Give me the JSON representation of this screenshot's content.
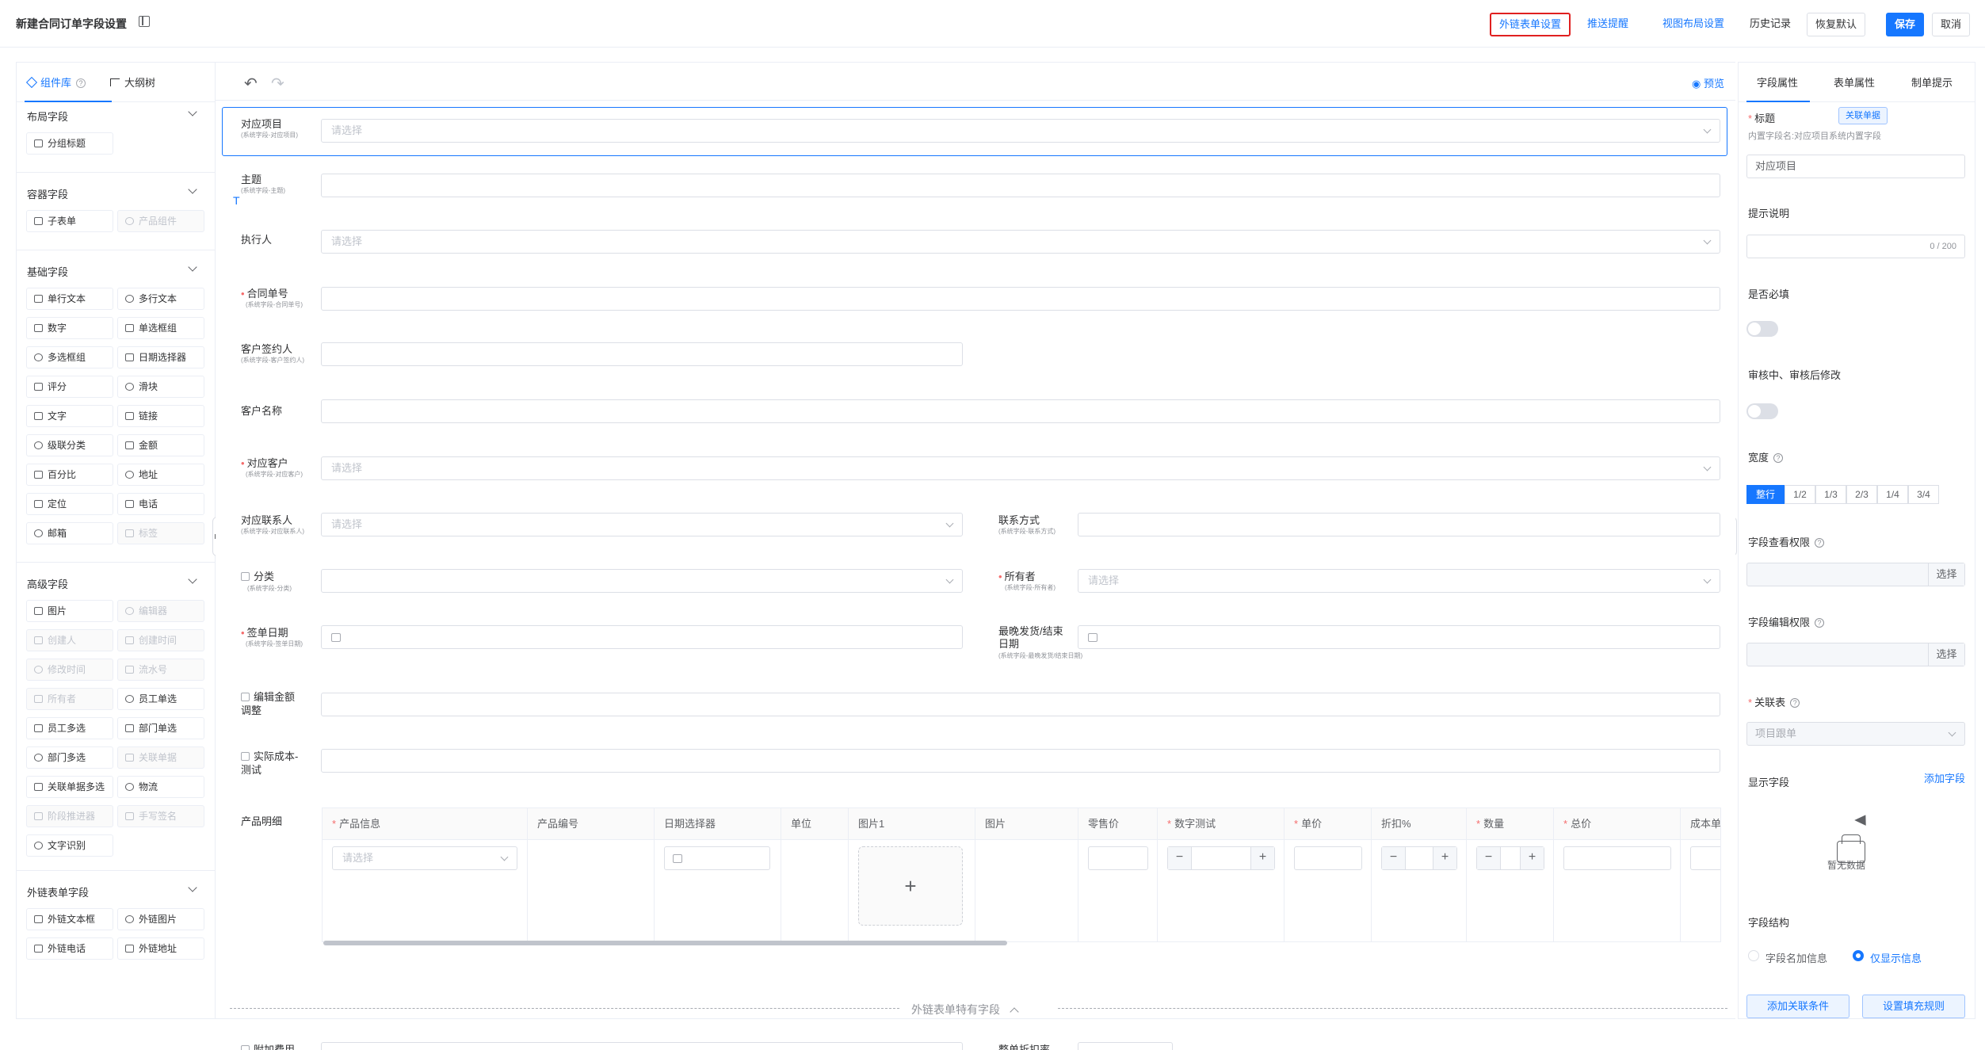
{
  "header": {
    "title": "新建合同订单字段设置",
    "actions": {
      "external_form": "外链表单设置",
      "push_reminder": "推送提醒",
      "view_layout": "视图布局设置",
      "history": "历史记录",
      "restore_default": "恢复默认",
      "save": "保存",
      "cancel": "取消"
    }
  },
  "left_panel": {
    "tabs": [
      "组件库",
      "大纲树"
    ],
    "groups": [
      {
        "title": "布局字段",
        "items": [
          {
            "label": "分组标题",
            "disabled": false
          }
        ]
      },
      {
        "title": "容器字段",
        "items": [
          {
            "label": "子表单",
            "disabled": false
          },
          {
            "label": "产品组件",
            "disabled": true
          }
        ]
      },
      {
        "title": "基础字段",
        "items": [
          {
            "label": "单行文本",
            "disabled": false
          },
          {
            "label": "多行文本",
            "disabled": false
          },
          {
            "label": "数字",
            "disabled": false
          },
          {
            "label": "单选框组",
            "disabled": false
          },
          {
            "label": "多选框组",
            "disabled": false
          },
          {
            "label": "日期选择器",
            "disabled": false
          },
          {
            "label": "评分",
            "disabled": false
          },
          {
            "label": "滑块",
            "disabled": false
          },
          {
            "label": "文字",
            "disabled": false
          },
          {
            "label": "链接",
            "disabled": false
          },
          {
            "label": "级联分类",
            "disabled": false
          },
          {
            "label": "金额",
            "disabled": false
          },
          {
            "label": "百分比",
            "disabled": false
          },
          {
            "label": "地址",
            "disabled": false
          },
          {
            "label": "定位",
            "disabled": false
          },
          {
            "label": "电话",
            "disabled": false
          },
          {
            "label": "邮箱",
            "disabled": false
          },
          {
            "label": "标签",
            "disabled": true
          }
        ]
      },
      {
        "title": "高级字段",
        "items": [
          {
            "label": "图片",
            "disabled": false
          },
          {
            "label": "编辑器",
            "disabled": true
          },
          {
            "label": "创建人",
            "disabled": true
          },
          {
            "label": "创建时间",
            "disabled": true
          },
          {
            "label": "修改时间",
            "disabled": true
          },
          {
            "label": "流水号",
            "disabled": true
          },
          {
            "label": "所有者",
            "disabled": true
          },
          {
            "label": "员工单选",
            "disabled": false
          },
          {
            "label": "员工多选",
            "disabled": false
          },
          {
            "label": "部门单选",
            "disabled": false
          },
          {
            "label": "部门多选",
            "disabled": false
          },
          {
            "label": "关联单据",
            "disabled": true
          },
          {
            "label": "关联单据多选",
            "disabled": false
          },
          {
            "label": "物流",
            "disabled": false
          },
          {
            "label": "阶段推进器",
            "disabled": true
          },
          {
            "label": "手写签名",
            "disabled": true
          },
          {
            "label": "文字识别",
            "disabled": false
          }
        ]
      },
      {
        "title": "外链表单字段",
        "items": [
          {
            "label": "外链文本框",
            "disabled": false
          },
          {
            "label": "外链图片",
            "disabled": false
          },
          {
            "label": "外链电话",
            "disabled": false
          },
          {
            "label": "外链地址",
            "disabled": false
          }
        ]
      }
    ]
  },
  "canvas": {
    "preview": "预览",
    "select_placeholder": "请选择",
    "fields": {
      "project": {
        "label": "对应项目",
        "sub": "(系统字段-对应项目)"
      },
      "subject": {
        "label": "主题",
        "sub": "(系统字段-主题)"
      },
      "executor": {
        "label": "执行人"
      },
      "contract_no": {
        "label": "合同单号",
        "sub": "(系统字段-合同单号)"
      },
      "signer": {
        "label": "客户签约人",
        "sub": "(系统字段-客户签约人)"
      },
      "customer_name": {
        "label": "客户名称"
      },
      "customer": {
        "label": "对应客户",
        "sub": "(系统字段-对应客户)"
      },
      "contact": {
        "label": "对应联系人",
        "sub": "(系统字段-对应联系人)"
      },
      "contact_method": {
        "label": "联系方式",
        "sub": "(系统字段-联系方式)"
      },
      "category": {
        "label": "分类",
        "sub": "(系统字段-分类)"
      },
      "owner": {
        "label": "所有者",
        "sub": "(系统字段-所有者)"
      },
      "sign_date": {
        "label": "签单日期",
        "sub": "(系统字段-签单日期)"
      },
      "latest_date": {
        "label1": "最晚发货/结束",
        "label2": "日期",
        "sub": "(系统字段-最晚发货/结束日期)"
      },
      "amount_adjust": {
        "label1": "编辑金额",
        "label2": "调整"
      },
      "cost_test": {
        "label1": "实际成本-",
        "label2": "测试"
      },
      "product_detail": {
        "label": "产品明细"
      },
      "extra_fee": {
        "label": "附加费用"
      },
      "discount": {
        "label": "整单折扣率"
      }
    },
    "product_table": {
      "columns": [
        {
          "label": "产品信息",
          "required": true
        },
        {
          "label": "产品编号",
          "required": false
        },
        {
          "label": "日期选择器",
          "required": false
        },
        {
          "label": "单位",
          "required": false
        },
        {
          "label": "图片1",
          "required": false
        },
        {
          "label": "图片",
          "required": false
        },
        {
          "label": "零售价",
          "required": false
        },
        {
          "label": "数字测试",
          "required": true
        },
        {
          "label": "单价",
          "required": true
        },
        {
          "label": "折扣%",
          "required": false
        },
        {
          "label": "数量",
          "required": true
        },
        {
          "label": "总价",
          "required": true
        },
        {
          "label": "成本单",
          "required": false
        }
      ],
      "upload_symbol": "+",
      "stepper_minus": "−",
      "stepper_plus": "+"
    },
    "footer_label": "外链表单特有字段"
  },
  "right_panel": {
    "tabs": [
      "字段属性",
      "表单属性",
      "制单提示"
    ],
    "title_label": "标题",
    "related_tag": "关联单据",
    "title_hint": "内置字段名:对应项目系统内置字段",
    "title_value": "对应项目",
    "tip_label": "提示说明",
    "tip_counter": "0 / 200",
    "required_label": "是否必填",
    "edit_after_audit_label": "审核中、审核后修改",
    "width_label": "宽度",
    "width_options": [
      "整行",
      "1/2",
      "1/3",
      "2/3",
      "1/4",
      "3/4"
    ],
    "width_selected": "整行",
    "view_perm_label": "字段查看权限",
    "edit_perm_label": "字段编辑权限",
    "select_btn": "选择",
    "related_table_label": "关联表",
    "related_table_value": "项目跟单",
    "display_fields_label": "显示字段",
    "add_field": "添加字段",
    "empty_text": "暂无数据",
    "structure_label": "字段结构",
    "structure_options": [
      "字段名加信息",
      "仅显示信息"
    ],
    "structure_selected": "仅显示信息",
    "add_condition": "添加关联条件",
    "fill_rule": "设置填充规则"
  },
  "colors": {
    "primary": "#1677ff",
    "required": "#f56c6c",
    "highlight_border": "#e02020"
  }
}
